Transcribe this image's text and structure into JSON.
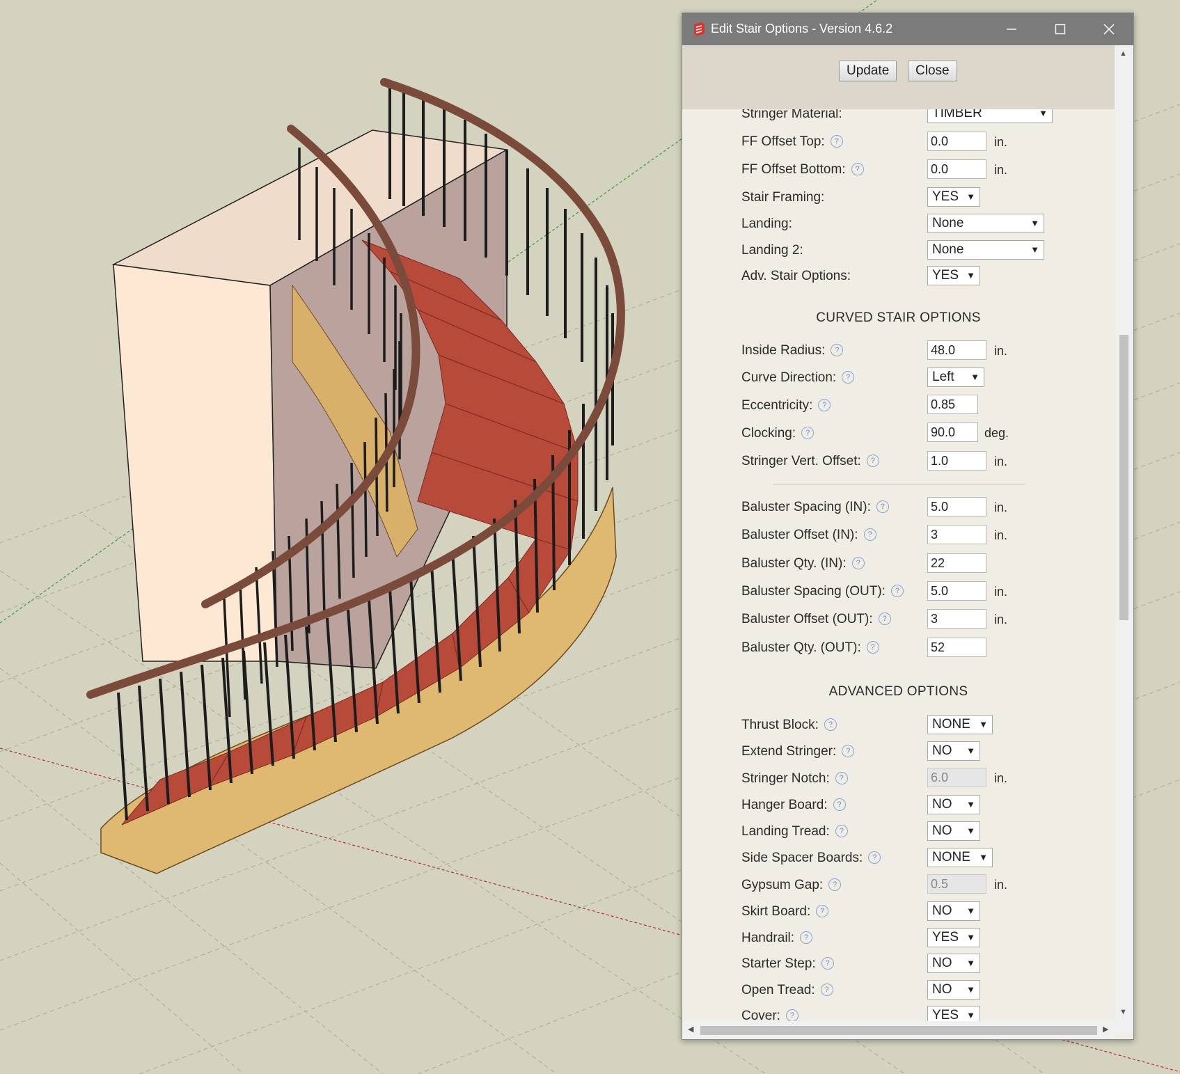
{
  "window": {
    "title": "Edit Stair Options - Version 4.6.2"
  },
  "toolbar": {
    "update_label": "Update",
    "close_label": "Close"
  },
  "rows": [
    {
      "label": "Stringer Material:",
      "kind": "select",
      "value": "TIMBER",
      "help": false
    },
    {
      "label": "FF Offset Top:",
      "kind": "input",
      "value": "0.0",
      "unit": "in.",
      "help": true
    },
    {
      "label": "FF Offset Bottom:",
      "kind": "input",
      "value": "0.0",
      "unit": "in.",
      "help": true
    },
    {
      "label": "Stair Framing:",
      "kind": "select",
      "value": "YES",
      "help": false
    },
    {
      "label": "Landing:",
      "kind": "select",
      "value": "None",
      "help": false
    },
    {
      "label": "Landing 2:",
      "kind": "select",
      "value": "None",
      "help": false
    },
    {
      "label": "Adv. Stair Options:",
      "kind": "select",
      "value": "YES",
      "help": false
    }
  ],
  "curved": {
    "heading": "CURVED STAIR OPTIONS",
    "rows": [
      {
        "label": "Inside Radius:",
        "kind": "input",
        "value": "48.0",
        "unit": "in."
      },
      {
        "label": "Curve Direction:",
        "kind": "select",
        "value": "Left"
      },
      {
        "label": "Eccentricity:",
        "kind": "input",
        "value": "0.85",
        "unit": ""
      },
      {
        "label": "Clocking:",
        "kind": "input",
        "value": "90.0",
        "unit": "deg."
      },
      {
        "label": "Stringer Vert. Offset:",
        "kind": "input",
        "value": "1.0",
        "unit": "in."
      }
    ],
    "baluster_rows": [
      {
        "label": "Baluster Spacing (IN):",
        "value": "5.0",
        "unit": "in."
      },
      {
        "label": "Baluster Offset (IN):",
        "value": "3",
        "unit": "in."
      },
      {
        "label": "Baluster Qty. (IN):",
        "value": "22",
        "unit": ""
      },
      {
        "label": "Baluster Spacing (OUT):",
        "value": "5.0",
        "unit": "in."
      },
      {
        "label": "Baluster Offset (OUT):",
        "value": "3",
        "unit": "in."
      },
      {
        "label": "Baluster Qty. (OUT):",
        "value": "52",
        "unit": ""
      }
    ]
  },
  "advanced": {
    "heading": "ADVANCED OPTIONS",
    "rows": [
      {
        "label": "Thrust Block:",
        "kind": "select",
        "value": "NONE"
      },
      {
        "label": "Extend Stringer:",
        "kind": "select",
        "value": "NO"
      },
      {
        "label": "Stringer Notch:",
        "kind": "input-disabled",
        "value": "6.0",
        "unit": "in."
      },
      {
        "label": "Hanger Board:",
        "kind": "select",
        "value": "NO"
      },
      {
        "label": "Landing Tread:",
        "kind": "select",
        "value": "NO"
      },
      {
        "label": "Side Spacer Boards:",
        "kind": "select",
        "value": "NONE"
      },
      {
        "label": "Gypsum Gap:",
        "kind": "input-disabled",
        "value": "0.5",
        "unit": "in."
      },
      {
        "label": "Skirt Board:",
        "kind": "select",
        "value": "NO"
      },
      {
        "label": "Handrail:",
        "kind": "select",
        "value": "YES"
      },
      {
        "label": "Starter Step:",
        "kind": "select",
        "value": "NO"
      },
      {
        "label": "Open Tread:",
        "kind": "select",
        "value": "NO"
      },
      {
        "label": "Cover:",
        "kind": "select",
        "value": "YES"
      }
    ]
  },
  "colors": {
    "ground": "#d3d3bf",
    "tread": "#b84a3a",
    "wood": "#e0b970",
    "handrail": "#7a4a3a",
    "titlebar": "#7b7b7b"
  }
}
